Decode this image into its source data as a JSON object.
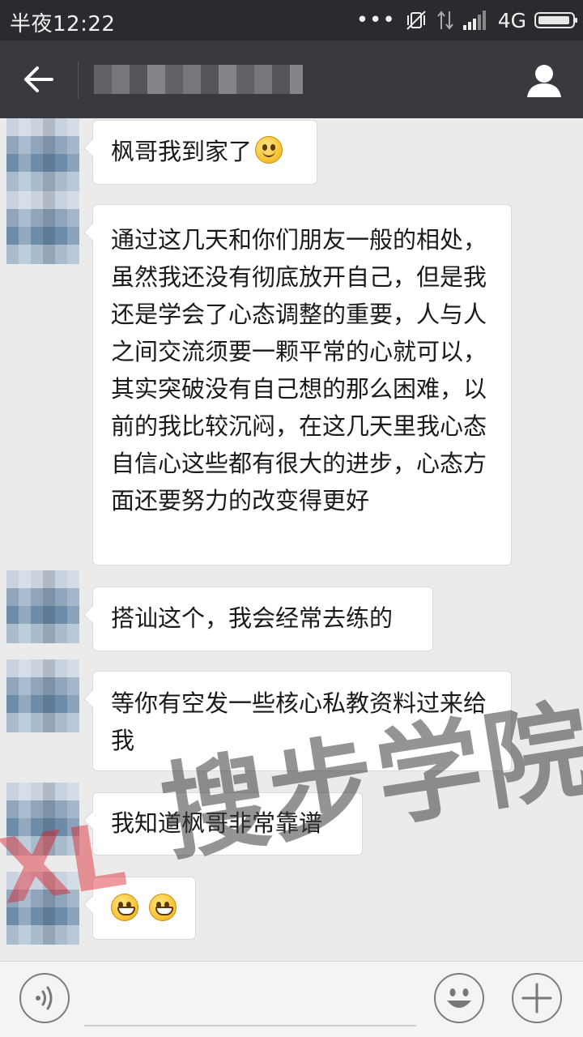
{
  "status_bar": {
    "time": "半夜12:22",
    "network": "4G",
    "icons": [
      "more-dots-icon",
      "vibrate-off-icon",
      "data-transfer-icon",
      "signal-icon",
      "battery-icon"
    ]
  },
  "title_bar": {
    "title": "",
    "back_icon": "back-arrow-icon",
    "profile_icon": "profile-icon",
    "bar_color": "#393a3f"
  },
  "messages": [
    {
      "text": "枫哥我到家了",
      "emoji": "smile"
    },
    {
      "text": "通过这几天和你们朋友一般的相处，虽然我还没有彻底放开自己，但是我还是学会了心态调整的重要，人与人之间交流须要一颗平常的心就可以，其实突破没有自己想的那么困难，以前的我比较沉闷，在这几天里我心态自信心这些都有很大的进步，心态方面还要努力的改变得更好"
    },
    {
      "text": "搭讪这个，我会经常去练的"
    },
    {
      "text": "等你有空发一些核心私教资料过来给我"
    },
    {
      "text": "我知道枫哥非常靠谱"
    },
    {
      "text": "",
      "emoji": "grin-grin"
    }
  ],
  "watermark": {
    "text": "搜步学院",
    "logo": "XL"
  },
  "bottom_bar": {
    "icons": [
      "voice-icon",
      "emoji-icon",
      "plus-icon"
    ]
  }
}
